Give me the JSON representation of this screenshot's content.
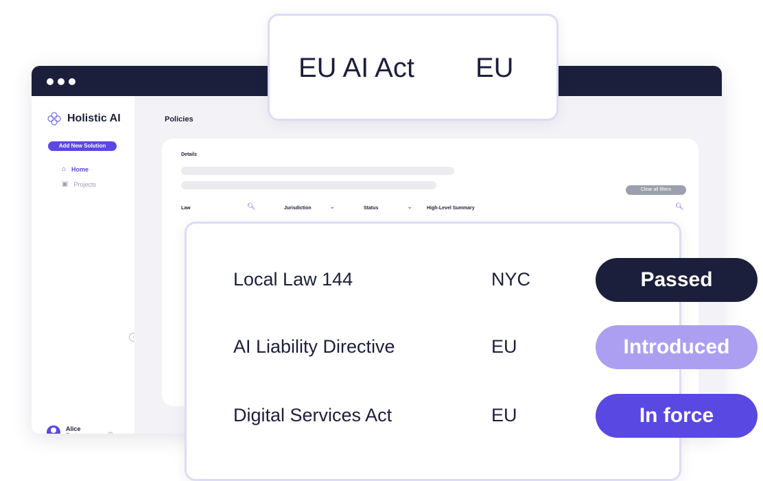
{
  "colors": {
    "titlebar": "#1b1f3b",
    "accent": "#5a48e3",
    "passed": "#1b1f3b",
    "introduced": "#ac9ff1",
    "in_force": "#5a48e3",
    "clear_filter": "#9aa0ad"
  },
  "window": {
    "dots": [
      "#ffffff",
      "#ffffff",
      "#ffffff"
    ]
  },
  "sidebar": {
    "logo_icon": "holistic-ai-logo",
    "brand": "Holistic AI",
    "add_button": "Add New Solution",
    "nav": [
      {
        "icon": "home-icon",
        "label": "Home",
        "active": true
      },
      {
        "icon": "clipboard-icon",
        "label": "Projects",
        "active": false
      }
    ],
    "user": {
      "name": "Alice",
      "role": "Reviewer"
    }
  },
  "main": {
    "title": "Policies",
    "details_label": "Details",
    "clear_filters": "Clear all filters",
    "columns": [
      "Law",
      "Jurisdiction",
      "Status",
      "High-Level Summary"
    ]
  },
  "popup_top": {
    "law": "EU AI Act",
    "jurisdiction": "EU"
  },
  "rows": [
    {
      "law": "Local Law 144",
      "jurisdiction": "NYC",
      "status": "Passed"
    },
    {
      "law": "AI Liability Directive",
      "jurisdiction": "EU",
      "status": "Introduced"
    },
    {
      "law": "Digital Services Act",
      "jurisdiction": "EU",
      "status": "In force"
    }
  ]
}
